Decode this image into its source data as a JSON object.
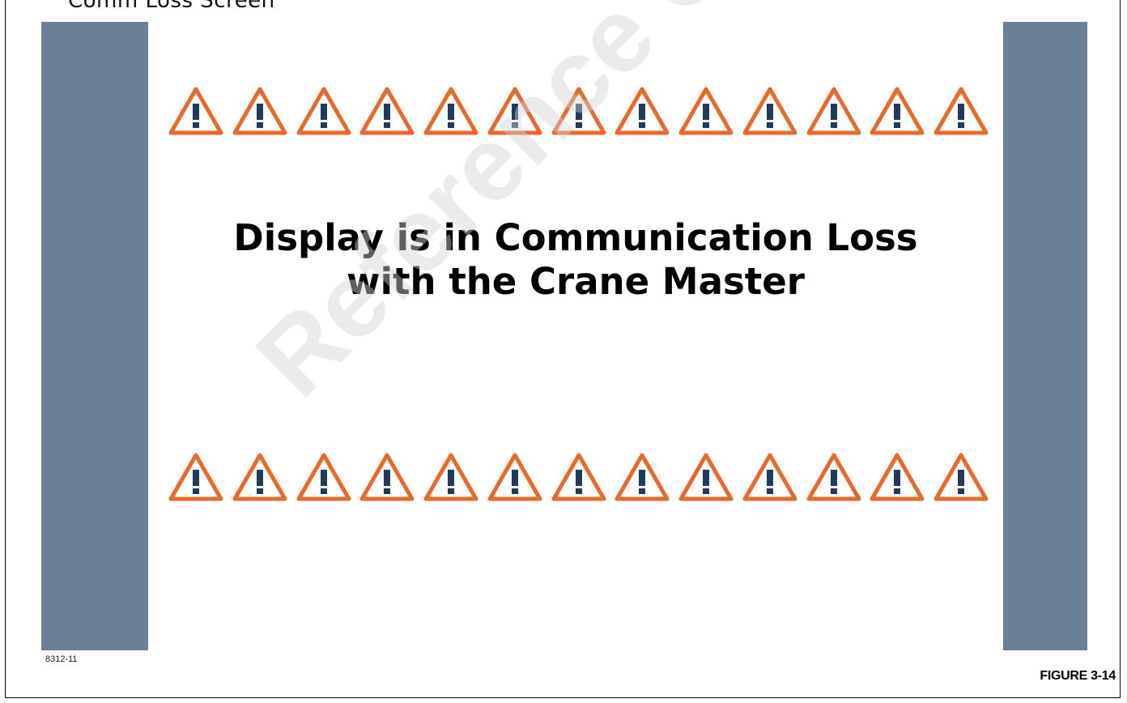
{
  "header": {
    "cut_text": "Comm Loss Screen"
  },
  "screen": {
    "message_line1": "Display is in Communication Loss",
    "message_line2": "with the Crane Master",
    "warning_icon": "warning-triangle-icon",
    "warning_count_per_row": 13
  },
  "watermark": {
    "text": "Reference Only"
  },
  "figure": {
    "code": "8312-11",
    "label": "FIGURE 3-14"
  },
  "colors": {
    "side_bar": "#6a7f98",
    "warning_outline": "#e8692a",
    "warning_mark": "#1f3a5c"
  }
}
